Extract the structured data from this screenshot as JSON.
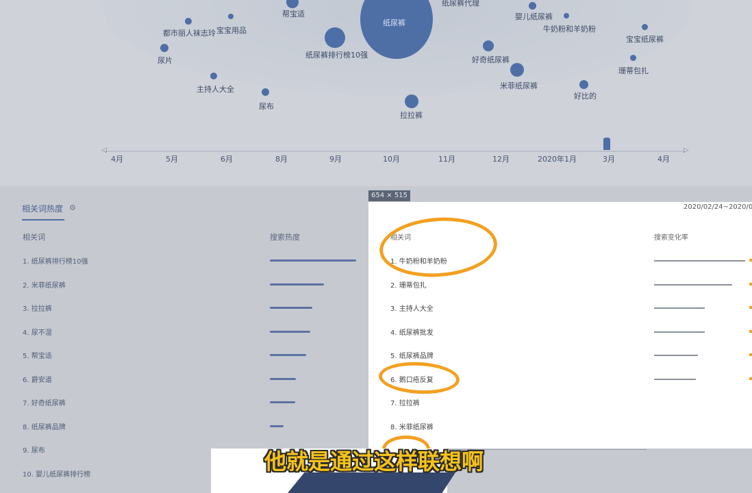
{
  "bubble_chart": {
    "bubbles": [
      {
        "label": "纸尿裤",
        "color": "#4e6ea6"
      },
      {
        "label": "纸尿裤代理",
        "color": "#4e6ea6"
      },
      {
        "label": "帮宝适",
        "color": "#4e6ea6"
      },
      {
        "label": "婴儿纸尿裤",
        "color": "#4e6ea6"
      },
      {
        "label": "都市丽人袜志玲",
        "color": "#4e6ea6"
      },
      {
        "label": "宝宝用品",
        "color": "#4e6ea6"
      },
      {
        "label": "牛奶粉和羊奶粉",
        "color": "#4e6ea6"
      },
      {
        "label": "宝宝纸尿裤",
        "color": "#4e6ea6"
      },
      {
        "label": "尿片",
        "color": "#4e6ea6"
      },
      {
        "label": "纸尿裤排行榜10强",
        "color": "#4e6ea6"
      },
      {
        "label": "好奇纸尿裤",
        "color": "#4e6ea6"
      },
      {
        "label": "珊蒂包扎",
        "color": "#4e6ea6"
      },
      {
        "label": "主持人大全",
        "color": "#4e6ea6"
      },
      {
        "label": "米菲纸尿裤",
        "color": "#4e6ea6"
      },
      {
        "label": "尿布",
        "color": "#4e6ea6"
      },
      {
        "label": "拉拉裤",
        "color": "#4e6ea6"
      },
      {
        "label": "好比的",
        "color": "#4e6ea6"
      }
    ],
    "timeline_months": [
      "4月",
      "5月",
      "6月",
      "8月",
      "9月",
      "10月",
      "11月",
      "12月",
      "2020年1月",
      "3月",
      "4月"
    ]
  },
  "related_section": {
    "title": "相关词热度",
    "col_word": "相关词",
    "col_heat": "搜索热度",
    "rows": [
      {
        "label": "1.  纸尿裤排行榜10强",
        "heat": 100
      },
      {
        "label": "2.  米菲纸尿裤",
        "heat": 63
      },
      {
        "label": "3.  拉拉裤",
        "heat": 49
      },
      {
        "label": "4.  尿不湿",
        "heat": 47
      },
      {
        "label": "5.  帮宝适",
        "heat": 42
      },
      {
        "label": "6.  爵安道",
        "heat": 30
      },
      {
        "label": "7.  好奇纸尿裤",
        "heat": 29
      },
      {
        "label": "8.  纸尿裤品牌",
        "heat": 16
      },
      {
        "label": "9.  尿布",
        "heat": 0
      },
      {
        "label": "10. 婴儿纸尿裤排行榜",
        "heat": 0
      }
    ]
  },
  "overlay_panel": {
    "size_badge": "654 × 515",
    "date_range": "2020/02/24~2020/0",
    "col_word": "相关词",
    "col_change": "搜索变化率",
    "rows": [
      {
        "label": "1.   牛奶粉和羊奶粉",
        "change": 100
      },
      {
        "label": "2.   珊蒂包扎",
        "change": 86
      },
      {
        "label": "3.   主持人大全",
        "change": 56
      },
      {
        "label": "4.   纸尿裤批发",
        "change": 56
      },
      {
        "label": "5.   纸尿裤品牌",
        "change": 48
      },
      {
        "label": "6.   鹅口疮反复",
        "change": 46
      },
      {
        "label": "7.   拉拉裤",
        "change": null
      },
      {
        "label": "8.   米菲纸尿裤",
        "change": null
      }
    ]
  },
  "subtitle": "他就是通过这样联想啊",
  "colors": {
    "accent": "#4e6ea6",
    "annotation": "#f3a020",
    "subtitle": "#f6c21b"
  }
}
